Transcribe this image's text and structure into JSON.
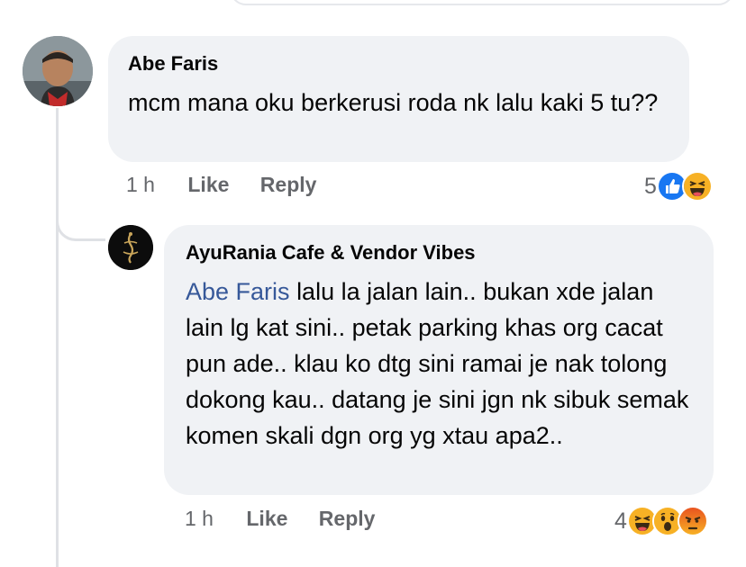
{
  "comments": [
    {
      "author": "Abe Faris",
      "text": "mcm mana oku berkerusi roda nk lalu kaki 5 tu??",
      "time": "1 h",
      "like_label": "Like",
      "reply_label": "Reply",
      "reaction_count": "5",
      "reactions": [
        "like-icon",
        "haha-icon"
      ]
    },
    {
      "author": "AyuRania Cafe & Vendor Vibes",
      "mention": "Abe Faris",
      "text": "lalu la jalan lain.. bukan xde jalan lain lg kat sini.. petak parking khas org cacat pun ade.. klau ko dtg sini ramai je nak tolong dokong kau.. datang je sini jgn nk sibuk semak komen skali dgn org yg xtau apa2..",
      "time": "1 h",
      "like_label": "Like",
      "reply_label": "Reply",
      "reaction_count": "4",
      "reactions": [
        "haha-icon",
        "wow-icon",
        "angry-icon"
      ]
    }
  ],
  "colors": {
    "bubble": "#f0f2f5",
    "mention": "#365899",
    "meta": "#65676b",
    "like_blue": "#1877f2",
    "emoji_yellow": "#f7b125"
  }
}
